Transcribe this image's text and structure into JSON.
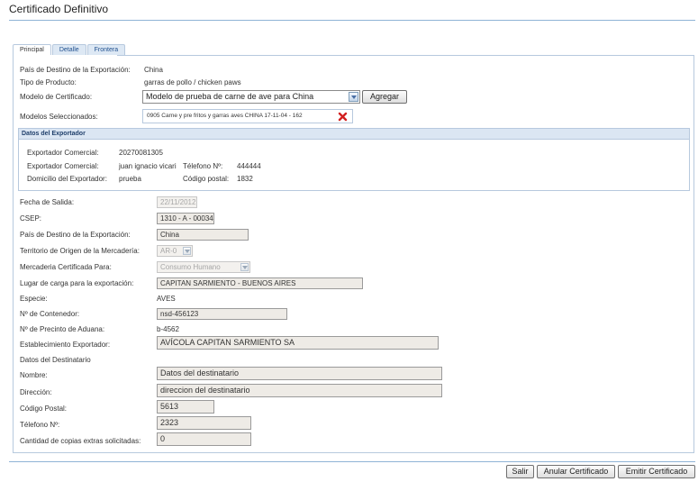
{
  "page_title": "Certificado Definitivo",
  "tabs": [
    {
      "label": "Principal"
    },
    {
      "label": "Detalle"
    },
    {
      "label": "Frontera"
    }
  ],
  "top": {
    "pais_label": "País de Destino de la Exportación:",
    "pais_value": "China",
    "tipo_label": "Tipo de Producto:",
    "tipo_value": "garras de pollo / chicken paws",
    "modelo_label": "Modelo de Certificado:",
    "modelo_value": "Modelo de prueba de carne de ave para China",
    "agregar_label": "Agregar",
    "seleccionados_label": "Modelos Seleccionados:",
    "seleccionados_value": "0905 Carne y pre fritos y garras aves CHINA 17-11-04 - 162"
  },
  "exportador": {
    "header": "Datos del Exportador",
    "comercial_label_1": "Exportador Comercial:",
    "comercial_value_1": "20270081305",
    "comercial_label_2": "Exportador Comercial:",
    "comercial_value_2": "juan ignacio vicari",
    "telefono_label": "Télefono Nº:",
    "telefono_value": "444444",
    "domicilio_label": "Domicilio del Exportador:",
    "domicilio_value": "prueba",
    "cp_label": "Código postal:",
    "cp_value": "1832"
  },
  "form": {
    "fecha_label": "Fecha de Salida:",
    "fecha_value": "22/11/2012",
    "csep_label": "CSEP:",
    "csep_value": "1310 - A - 00034",
    "pais_label": "País de Destino de la Exportación:",
    "pais_value": "China",
    "territorio_label": "Territorio de Origen de la Mercadería:",
    "territorio_value": "AR-0",
    "mercaderia_label": "Mercaderia Certificada Para:",
    "mercaderia_value": "Consumo Humano",
    "lugar_label": "Lugar de carga para la exportación:",
    "lugar_value": "CAPITAN SARMIENTO - BUENOS AIRES",
    "especie_label": "Especie:",
    "especie_value": "AVES",
    "contenedor_label": "Nº de Contenedor:",
    "contenedor_value": "nsd-456123",
    "precinto_label": "Nº de Precinto de Aduana:",
    "precinto_value": "b-4562",
    "establecimiento_label": "Establecimiento Exportador:",
    "establecimiento_value": "AVÍCOLA CAPITAN SARMIENTO SA",
    "destinatario_heading": "Datos del Destinatario",
    "nombre_label": "Nombre:",
    "nombre_value": "Datos del destinatario",
    "direccion_label": "Dirección:",
    "direccion_value": "direccion del destinatario",
    "cp_label": "Código Postal:",
    "cp_value": "5613",
    "telefono_label": "Télefono Nº:",
    "telefono_value": "2323",
    "copias_label": "Cantidad de copias extras solicitadas:",
    "copias_value": "0"
  },
  "buttons": {
    "salir": "Salir",
    "anular": "Anular Certificado",
    "emitir": "Emitir Certificado"
  },
  "colors": {
    "accent": "#1f4f8e",
    "border": "#b7c9de",
    "remove_icon": "#d22020"
  }
}
